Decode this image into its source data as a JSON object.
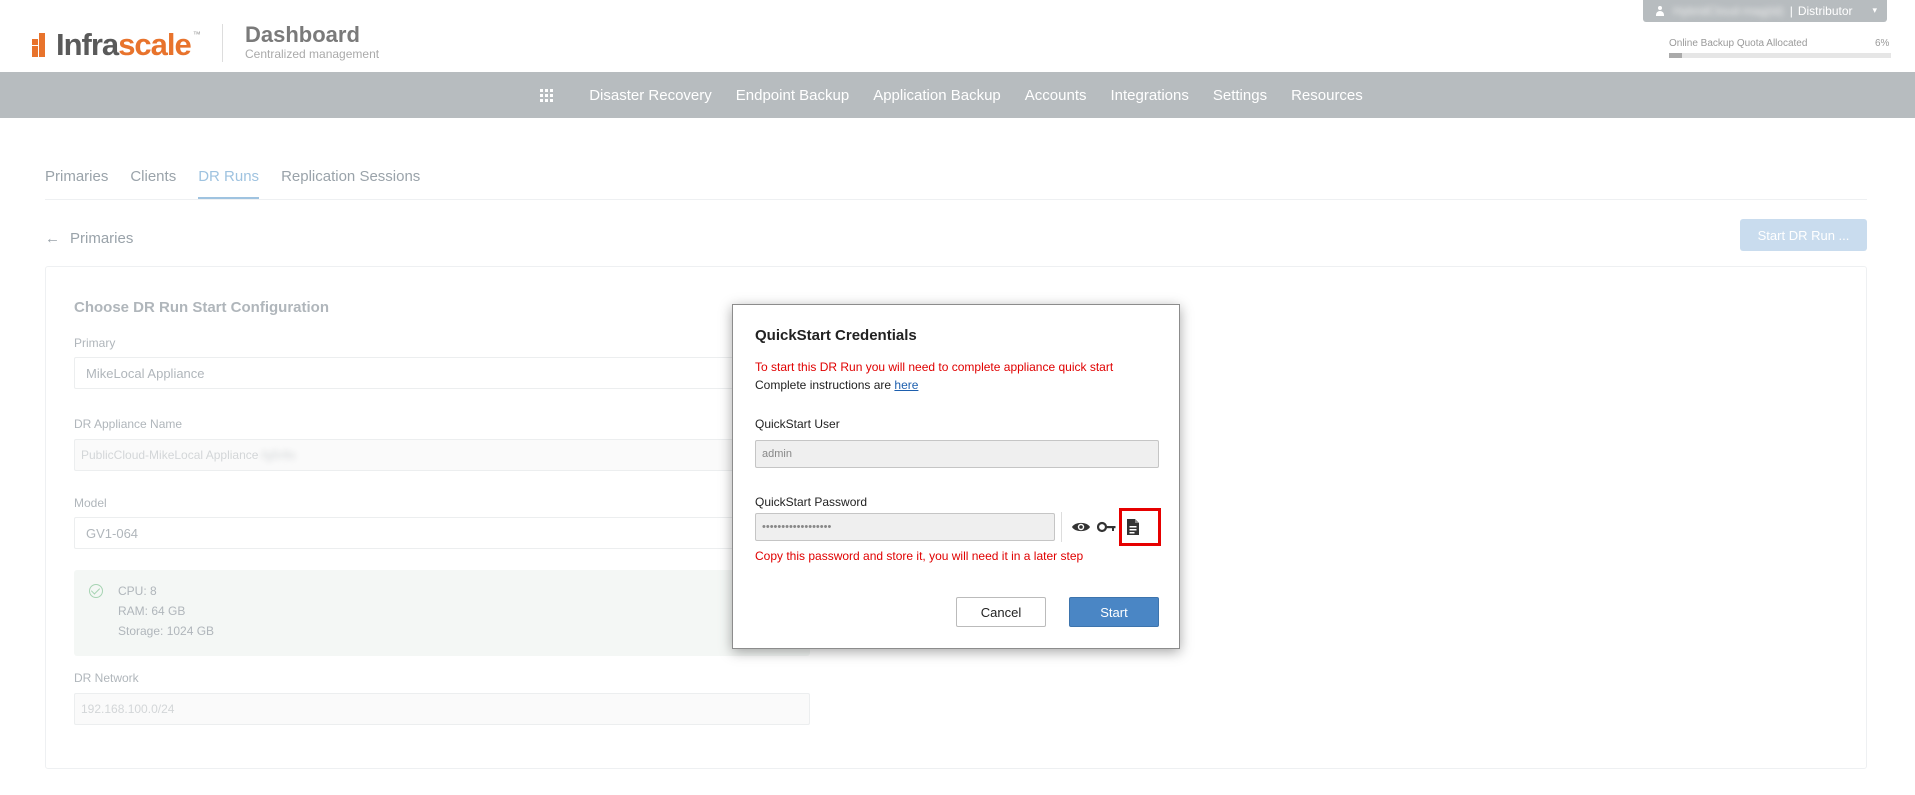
{
  "header": {
    "logo_prefix": "Infra",
    "logo_suffix": "scale",
    "logo_tm": "™",
    "title": "Dashboard",
    "subtitle": "Centralized management",
    "user": {
      "name": "HybridCloud-mag(id)",
      "separator": "|",
      "role": "Distributor",
      "icon": "user-icon",
      "caret": "▾"
    },
    "quota": {
      "label": "Online Backup Quota Allocated",
      "percent_text": "6%",
      "percent_value": 6
    }
  },
  "nav": {
    "grid_icon": "apps-grid-icon",
    "items": [
      "Disaster Recovery",
      "Endpoint Backup",
      "Application Backup",
      "Accounts",
      "Integrations",
      "Settings",
      "Resources"
    ]
  },
  "tabs": [
    {
      "label": "Primaries",
      "active": false
    },
    {
      "label": "Clients",
      "active": false
    },
    {
      "label": "DR Runs",
      "active": true
    },
    {
      "label": "Replication Sessions",
      "active": false
    }
  ],
  "back": {
    "arrow": "←",
    "label": "Primaries"
  },
  "start_run_button": "Start DR Run ...",
  "config": {
    "title": "Choose DR Run Start Configuration",
    "primary_label": "Primary",
    "primary_value": "MikeLocal Appliance",
    "appliance_name_label": "DR Appliance Name",
    "appliance_name_value": "PublicCloud-MikeLocal Appliance",
    "appliance_name_suffix": "-fg5r8s",
    "model_label": "Model",
    "model_value": "GV1-064",
    "specs": [
      "CPU: 8",
      "RAM: 64 GB",
      "Storage: 1024 GB"
    ],
    "network_label": "DR Network",
    "network_value": "192.168.100.0/24"
  },
  "modal": {
    "title": "QuickStart Credentials",
    "warning": "To start this DR Run you will need to complete appliance quick start",
    "instructions_prefix": "Complete instructions are ",
    "instructions_link": "here",
    "user_label": "QuickStart User",
    "user_value": "admin",
    "password_label": "QuickStart Password",
    "password_value": "••••••••••••••••••",
    "password_note": "Copy this password and store it, you will need it in a later step",
    "icons": [
      "eye-icon",
      "key-icon",
      "copy-document-icon"
    ],
    "cancel_label": "Cancel",
    "start_label": "Start"
  },
  "colors": {
    "nav_bg": "#b7bcbf",
    "brand_orange": "#e8732c",
    "active_tab": "#9fc3e0",
    "warning_red": "#e00000",
    "primary_button": "#4a86c5",
    "highlight_box": "#e60000"
  }
}
